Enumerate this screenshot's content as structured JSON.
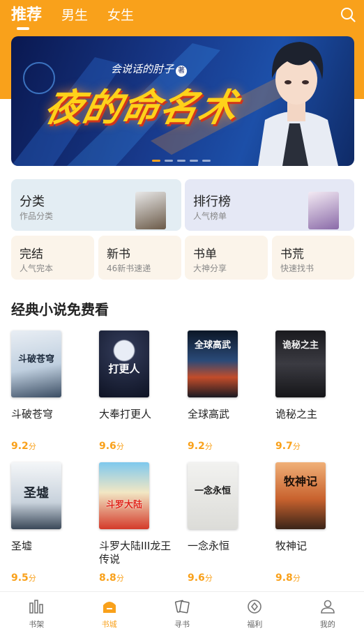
{
  "tabs": [
    {
      "label": "推荐"
    },
    {
      "label": "男生"
    },
    {
      "label": "女生"
    }
  ],
  "banner": {
    "author": "会说话的肘子",
    "badge": "著",
    "title": "夜的命名术"
  },
  "categories": [
    {
      "title": "分类",
      "subtitle": "作品分类"
    },
    {
      "title": "排行榜",
      "subtitle": "人气榜单"
    },
    {
      "title": "完结",
      "subtitle": "人气完本"
    },
    {
      "title": "新书",
      "subtitle": "46新书速递"
    },
    {
      "title": "书单",
      "subtitle": "大神分享"
    },
    {
      "title": "书荒",
      "subtitle": "快速找书"
    }
  ],
  "section": {
    "title": "经典小说免费看"
  },
  "books": [
    {
      "name": "斗破苍穹",
      "score": "9.2",
      "unit": "分",
      "cover_text": "斗破苍穹"
    },
    {
      "name": "大奉打更人",
      "score": "9.6",
      "unit": "分",
      "cover_text": "打更人"
    },
    {
      "name": "全球高武",
      "score": "9.2",
      "unit": "分",
      "cover_text": "全球高武"
    },
    {
      "name": "诡秘之主",
      "score": "9.7",
      "unit": "分",
      "cover_text": "诡秘之主"
    },
    {
      "name": "圣墟",
      "score": "9.5",
      "unit": "分",
      "cover_text": "圣墟"
    },
    {
      "name": "斗罗大陆III龙王传说",
      "score": "8.8",
      "unit": "分",
      "cover_text": "斗罗大陆"
    },
    {
      "name": "一念永恒",
      "score": "9.6",
      "unit": "分",
      "cover_text": "一念永恒"
    },
    {
      "name": "牧神记",
      "score": "9.8",
      "unit": "分",
      "cover_text": "牧神记"
    }
  ],
  "bottom_nav": [
    {
      "label": "书架",
      "icon": "bookshelf-icon"
    },
    {
      "label": "书城",
      "icon": "bookstore-icon"
    },
    {
      "label": "寻书",
      "icon": "find-book-icon"
    },
    {
      "label": "福利",
      "icon": "welfare-icon"
    },
    {
      "label": "我的",
      "icon": "profile-icon"
    }
  ],
  "colors": {
    "accent": "#f9a11b"
  }
}
